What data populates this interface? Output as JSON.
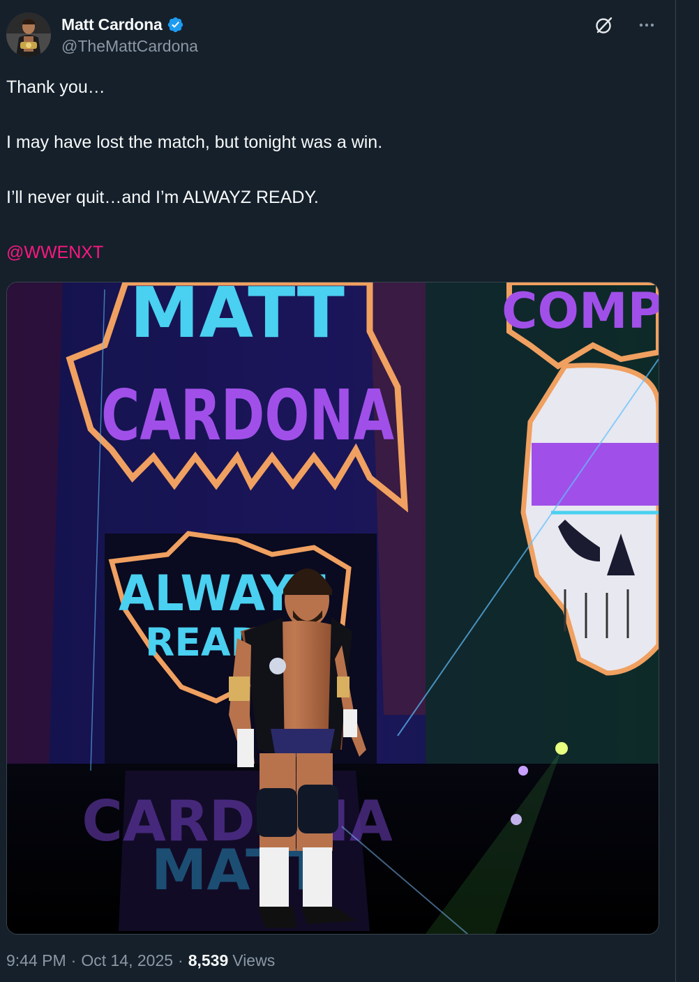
{
  "author": {
    "display_name": "Matt Cardona",
    "handle": "@TheMattCardona",
    "verified": true
  },
  "tweet": {
    "lines": [
      "Thank you…",
      "I may have lost the match, but tonight was a win.",
      "I’ll never quit…and I’m ALWAYZ READY.",
      "@WWENXT"
    ],
    "mention": "@WWENXT"
  },
  "media": {
    "sign_text_1": "MATT",
    "sign_text_2": "CARDONA",
    "sign_text_3": "ALWAYZ",
    "sign_text_4": "READY",
    "sign_text_5": "COMP"
  },
  "meta": {
    "time": "9:44 PM",
    "date": "Oct 14, 2025",
    "views_count": "8,539",
    "views_label": "Views"
  },
  "colors": {
    "background": "#15202b",
    "text": "#f7f9f9",
    "secondary": "#8b98a5",
    "mention": "#f91880",
    "verified": "#1d9bf0"
  },
  "icons": [
    "verified-badge-icon",
    "grok-icon",
    "more-icon"
  ]
}
